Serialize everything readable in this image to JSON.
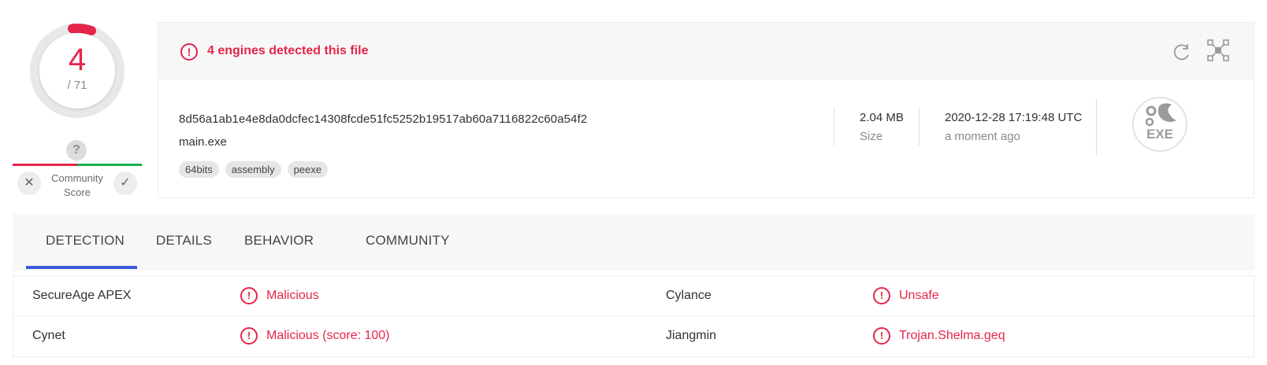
{
  "score": {
    "detected": "4",
    "total": "/ 71"
  },
  "community": {
    "label_line1": "Community",
    "label_line2": "Score",
    "unknown_icon": "?"
  },
  "alert": {
    "text": "4 engines detected this file",
    "icon": "!"
  },
  "file": {
    "hash": "8d56a1ab1e4e8da0dcfec14308fcde51fc5252b19517ab60a7116822c60a54f2",
    "name": "main.exe",
    "tags": [
      "64bits",
      "assembly",
      "peexe"
    ],
    "size": "2.04 MB",
    "size_label": "Size",
    "date": "2020-12-28 17:19:48 UTC",
    "date_relative": "a moment ago",
    "type_badge": "EXE"
  },
  "tabs": [
    {
      "label": "DETECTION",
      "active": true
    },
    {
      "label": "DETAILS",
      "active": false
    },
    {
      "label": "BEHAVIOR",
      "active": false
    },
    {
      "label": "COMMUNITY",
      "active": false
    }
  ],
  "detections": [
    {
      "engine": "SecureAge APEX",
      "result": "Malicious"
    },
    {
      "engine": "Cylance",
      "result": "Unsafe"
    },
    {
      "engine": "Cynet",
      "result": "Malicious (score: 100)"
    },
    {
      "engine": "Jiangmin",
      "result": "Trojan.Shelma.geq"
    }
  ],
  "colors": {
    "malicious": "#e5254a",
    "harmless": "#16b050",
    "accent": "#3b5bdb"
  },
  "icons": {
    "alert": "alert-circle-icon",
    "refresh": "refresh-icon",
    "graph": "graph-summary-icon",
    "downvote": "close-icon",
    "upvote": "check-icon",
    "file_type": "exe-file-icon"
  }
}
